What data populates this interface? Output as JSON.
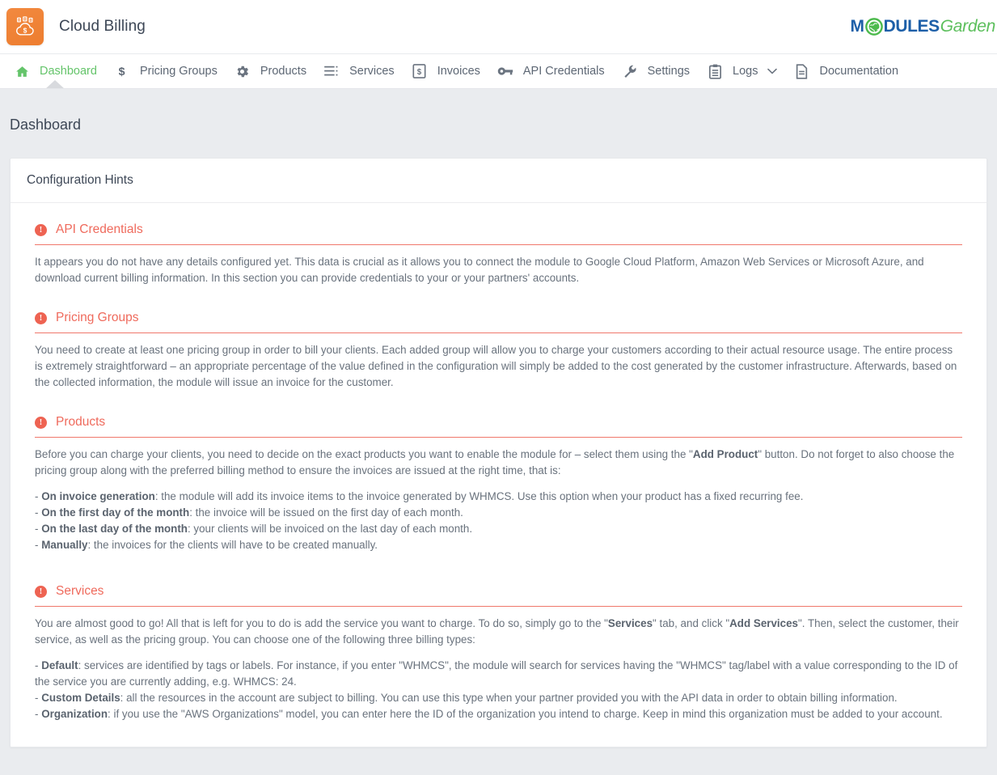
{
  "header": {
    "app_title": "Cloud Billing",
    "logo_icon": "cloud-dollar-icon",
    "brand_logo_bg": "#ed7d2f",
    "vendor_logo": {
      "part1": "M",
      "globe_icon": "globe-icon",
      "part2": "DULES",
      "part3": "Garden",
      "blue": "#1d5fa8",
      "green": "#5cbf5c"
    }
  },
  "nav": {
    "active_color": "#64c46a",
    "items": [
      {
        "label": "Dashboard",
        "icon": "home-icon",
        "active": true
      },
      {
        "label": "Pricing Groups",
        "icon": "dollar-icon",
        "active": false
      },
      {
        "label": "Products",
        "icon": "gear-icon",
        "active": false
      },
      {
        "label": "Services",
        "icon": "list-icon",
        "active": false
      },
      {
        "label": "Invoices",
        "icon": "invoice-icon",
        "active": false
      },
      {
        "label": "API Credentials",
        "icon": "key-icon",
        "active": false
      },
      {
        "label": "Settings",
        "icon": "wrench-icon",
        "active": false
      },
      {
        "label": "Logs",
        "icon": "clipboard-icon",
        "active": false,
        "caret": "chevron-down-icon"
      },
      {
        "label": "Documentation",
        "icon": "document-icon",
        "active": false
      }
    ]
  },
  "page": {
    "title": "Dashboard",
    "card_title": "Configuration Hints",
    "accent_color": "#ee6352"
  },
  "hints": [
    {
      "title": "API Credentials",
      "icon": "exclamation-circle-icon",
      "paragraph": "It appears you do not have any details configured yet. This data is crucial as it allows you to connect the module to Google Cloud Platform, Amazon Web Services or Microsoft Azure, and download current billing information. In this section you can provide credentials to your or your partners' accounts.",
      "items": []
    },
    {
      "title": "Pricing Groups",
      "icon": "exclamation-circle-icon",
      "paragraph": "You need to create at least one pricing group in order to bill your clients. Each added group will allow you to charge your customers according to their actual resource usage. The entire process is extremely straightforward – an appropriate percentage of the value defined in the configuration will simply be added to the cost generated by the customer infrastructure. Afterwards, based on the collected information, the module will issue an invoice for the customer.",
      "items": []
    },
    {
      "title": "Products",
      "icon": "exclamation-circle-icon",
      "paragraph_pre": "Before you can charge your clients, you need to decide on the exact products you want to enable the module for – select them using the \"",
      "paragraph_bold": "Add Product",
      "paragraph_post": "\" button. Do not forget to also choose the pricing group along with the preferred billing method to ensure the invoices are issued at the right time, that is:",
      "items": [
        {
          "prefix": "- ",
          "bold": "On invoice generation",
          "rest": ": the module will add its invoice items to the invoice generated by WHMCS. Use this option when your product has a fixed recurring fee."
        },
        {
          "prefix": "- ",
          "bold": "On the first day of the month",
          "rest": ": the invoice will be issued on the first day of each month."
        },
        {
          "prefix": "- ",
          "bold": "On the last day of the month",
          "rest": ": your clients will be invoiced on the last day of each month."
        },
        {
          "prefix": "- ",
          "bold": "Manually",
          "rest": ": the invoices for the clients will have to be created manually."
        }
      ]
    },
    {
      "title": "Services",
      "icon": "exclamation-circle-icon",
      "paragraph_pre": "You are almost good to go! All that is left for you to do is add the service you want to charge. To do so, simply go to the \"",
      "paragraph_bold": "Services",
      "paragraph_mid": "\" tab, and click \"",
      "paragraph_bold2": "Add Services",
      "paragraph_post": "\". Then, select the customer, their service, as well as the pricing group. You can choose one of the following three billing types:",
      "items": [
        {
          "prefix": "- ",
          "bold": "Default",
          "rest": ": services are identified by tags or labels. For instance, if you enter \"WHMCS\", the module will search for services having the \"WHMCS\" tag/label with a value corresponding to the ID of the service you are currently adding, e.g. WHMCS: 24."
        },
        {
          "prefix": "- ",
          "bold": "Custom Details",
          "rest": ": all the resources in the account are subject to billing. You can use this type when your partner provided you with the API data in order to obtain billing information."
        },
        {
          "prefix": "- ",
          "bold": "Organization",
          "rest": ": if you use the \"AWS Organizations\" model, you can enter here the ID of the organization you intend to charge. Keep in mind this organization must be added to your account."
        }
      ]
    }
  ]
}
